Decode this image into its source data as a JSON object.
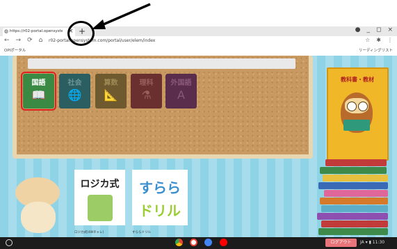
{
  "browser": {
    "tab_title": "https://r02-portal.opensystem.../",
    "tab_close": "×",
    "new_tab": "+",
    "window_controls": [
      "●",
      "_",
      "◻",
      "×"
    ],
    "nav": [
      "←",
      "→",
      "⟳",
      "⌂"
    ],
    "url": "r02-portal.opensystem.com/portal/user/elem/index",
    "addr_icons": [
      "☆",
      "✱",
      "⋮"
    ],
    "bookmark_left": "OPIポータル",
    "bookmark_right": "リーディングリスト"
  },
  "subjects": [
    {
      "label": "国語",
      "icon": "📖"
    },
    {
      "label": "社会",
      "icon": "🌐"
    },
    {
      "label": "算数",
      "icon": "📐"
    },
    {
      "label": "理科",
      "icon": "⚗"
    },
    {
      "label": "外国語",
      "icon": "A"
    }
  ],
  "book_panel": {
    "title": "教科書・教材"
  },
  "apps": {
    "logi_title": "ロジカ式",
    "logi_label": "ロジカ式[4Wチャレ]",
    "sura_title_1": "すらら",
    "sura_title_2": "ドリル",
    "sura_label": "すららドリル"
  },
  "taskbar": {
    "logout": "ログアウト",
    "status": "JA ▾ ▮ 11:30"
  },
  "colors": {
    "annotation": "#000000",
    "logout": "#e9747a",
    "selected_outline": "#e02020"
  }
}
